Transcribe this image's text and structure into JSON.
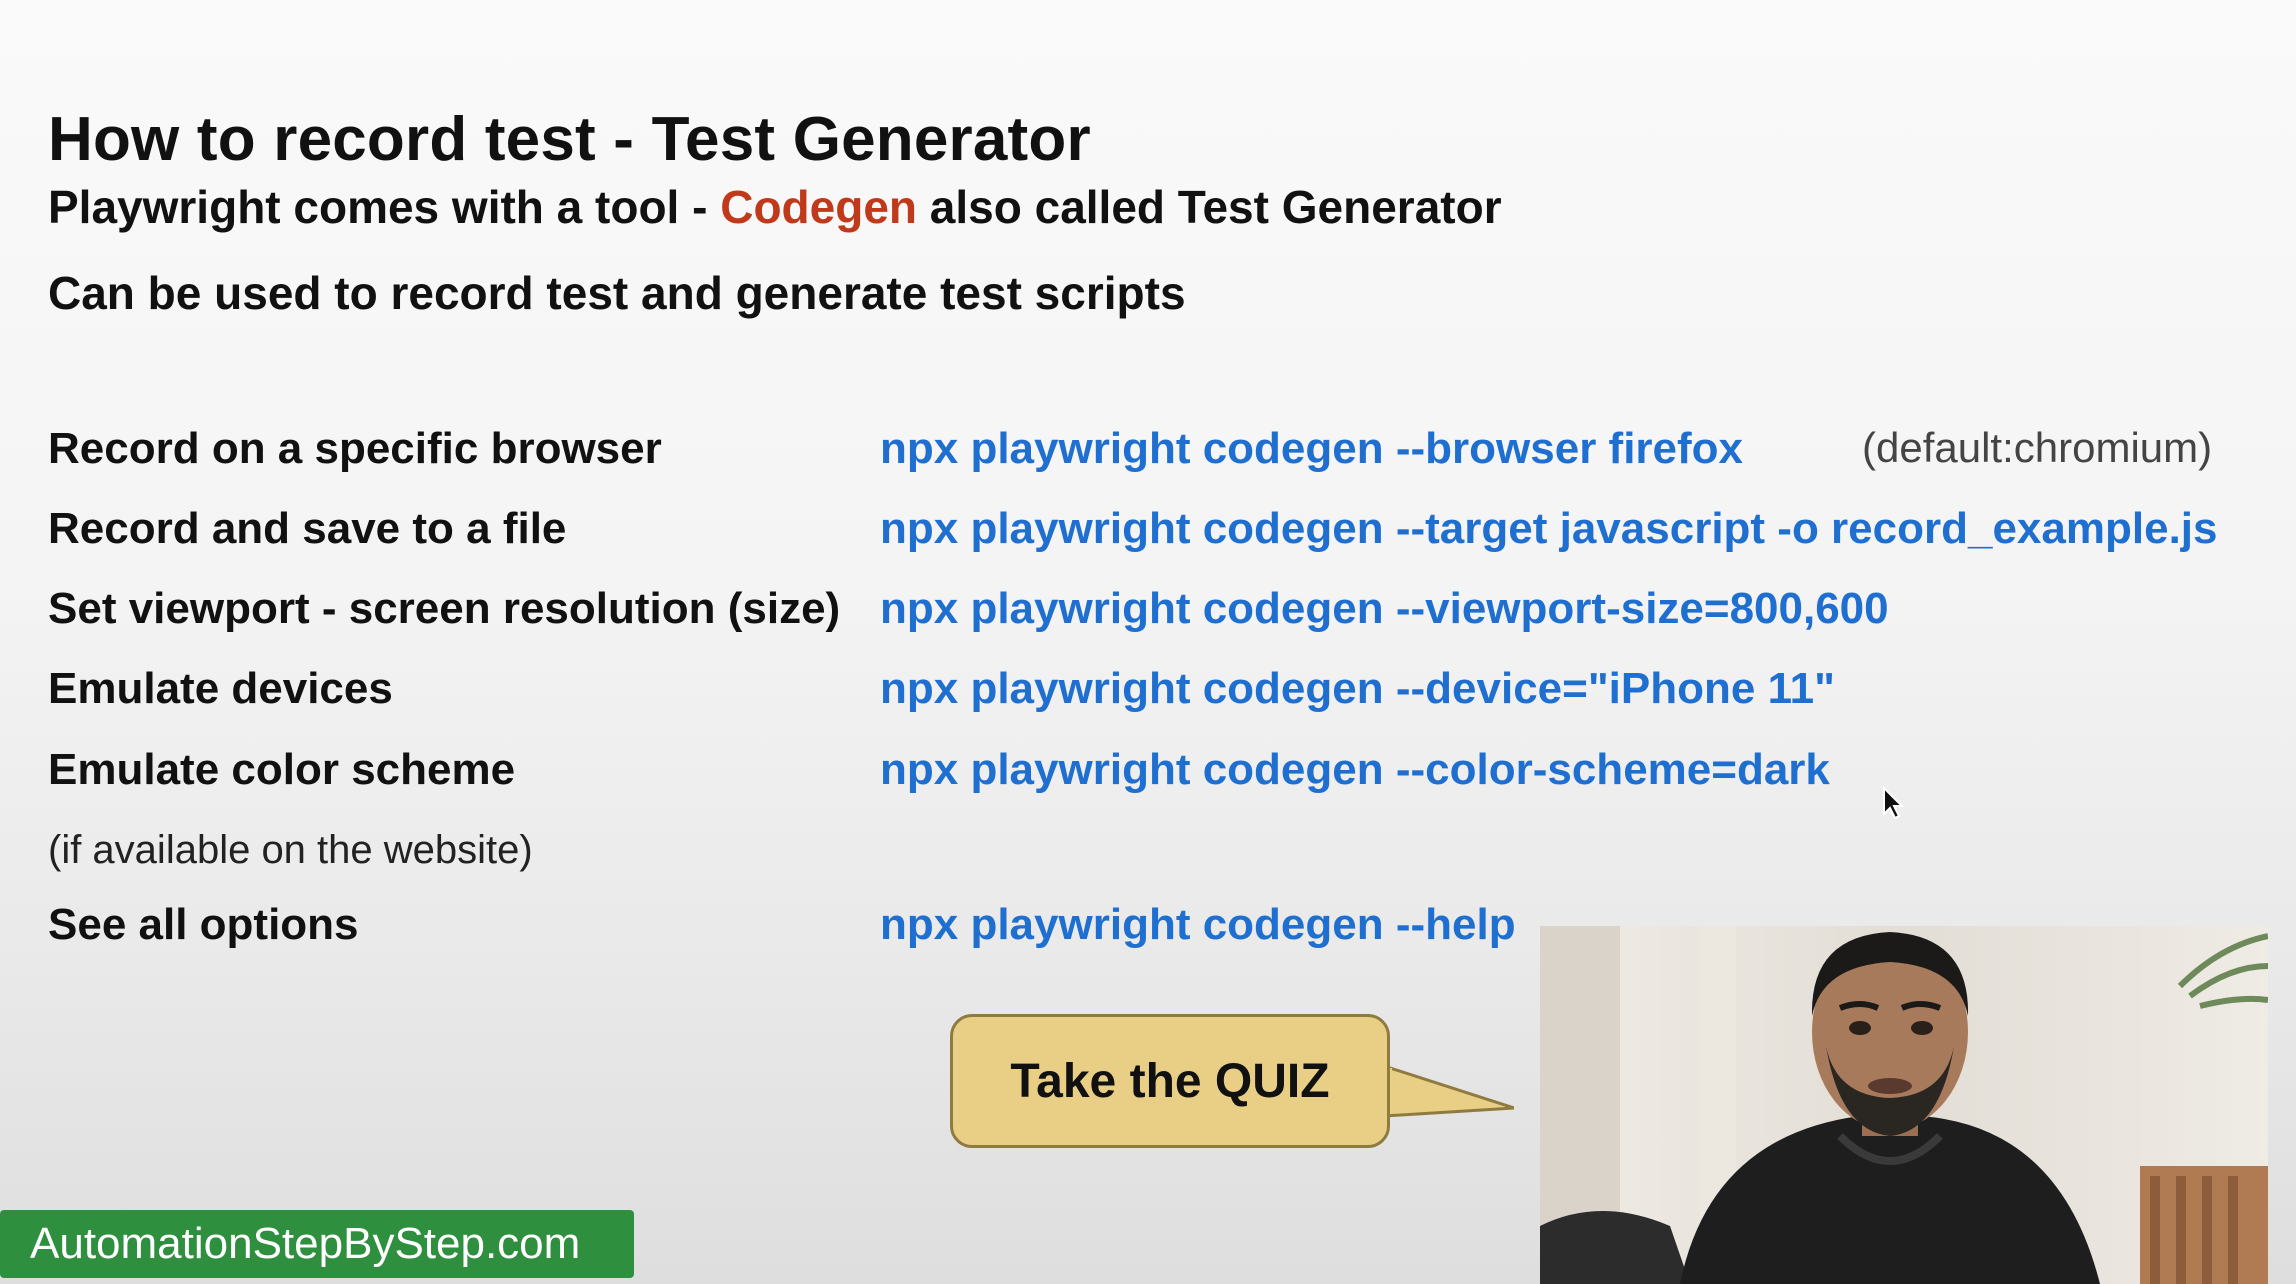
{
  "slide": {
    "title": "How to record test - Test Generator",
    "intro_line_1_prefix": "Playwright comes with a tool - ",
    "intro_line_1_highlight": "Codegen",
    "intro_line_1_suffix": " also called Test Generator",
    "intro_line_2": "Can be used to record test and generate test scripts",
    "highlight_color": "#c0391b",
    "command_color": "#1f6fd1"
  },
  "commands": [
    {
      "label": "Record on a specific browser",
      "command": "npx playwright codegen --browser firefox",
      "note": "(default:chromium)"
    },
    {
      "label": "Record and save to a file",
      "command": "npx playwright codegen --target javascript -o record_example.js"
    },
    {
      "label": "Set viewport - screen resolution (size)",
      "command": "npx playwright codegen --viewport-size=800,600"
    },
    {
      "label": "Emulate devices",
      "command": "npx playwright codegen --device=\"iPhone 11\""
    },
    {
      "label": "Emulate color scheme",
      "command": "npx playwright codegen --color-scheme=dark",
      "sub_note": "(if available on the website)"
    },
    {
      "label": "See all options",
      "command": "npx playwright codegen --help"
    }
  ],
  "quiz": {
    "label": "Take the QUIZ",
    "color": "#e8cf85"
  },
  "branding": {
    "site": "AutomationStepByStep.com",
    "color": "#2e8f3e"
  },
  "webcam": {
    "icon": "presenter-video"
  }
}
